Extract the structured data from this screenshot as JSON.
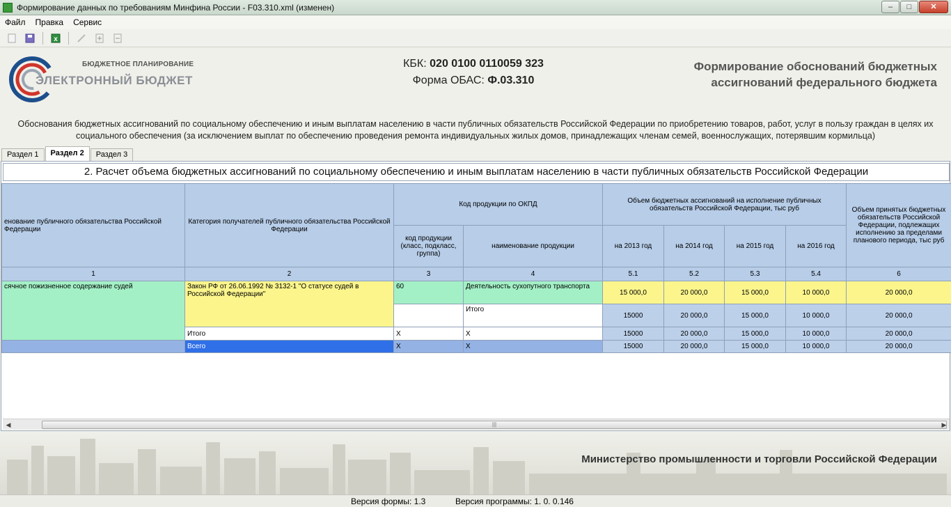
{
  "window": {
    "title": "Формирование данных по требованиям Минфина России - F03.310.xml (изменен)",
    "buttons": {
      "minimize": "–",
      "maximize": "□",
      "close": "✕"
    }
  },
  "menu": [
    "Файл",
    "Правка",
    "Сервис"
  ],
  "toolbar": {
    "icons": [
      "new-document-icon",
      "save-icon",
      "excel-export-icon",
      "edit-icon",
      "add-row-icon",
      "remove-row-icon"
    ]
  },
  "header": {
    "logo_small": "БЮДЖЕТНОЕ ПЛАНИРОВАНИЕ",
    "logo_big": "ЭЛЕКТРОННЫЙ БЮДЖЕТ",
    "kbk_label": "КБК:",
    "kbk_value": "020 0100 0110059 323",
    "form_label": "Форма ОБАС:",
    "form_value": "Ф.03.310",
    "title_line1": "Формирование обоснований бюджетных",
    "title_line2": "ассигнований федерального бюджета"
  },
  "description": {
    "line1": "Обоснования бюджетных ассигнований по социальному обеспечению и иным выплатам населению в части публичных обязательств Российской Федерации по приобретению товаров, работ, услуг в пользу граждан в целях их",
    "line2": "социального обеспечения (за исключением выплат по обеспечению проведения ремонта индивидуальных жилых домов, принадлежащих членам семей, военнослужащих, потерявшим кормильца)"
  },
  "tabs": [
    {
      "label": "Раздел 1",
      "active": false
    },
    {
      "label": "Раздел 2",
      "active": true
    },
    {
      "label": "Раздел 3",
      "active": false
    }
  ],
  "section": {
    "title": "2. Расчет объема бюджетных ассигнований по социальному обеспечению и иным выплатам населению в части публичных обязательств Российской Федерации"
  },
  "grid": {
    "headers": {
      "col1": "енование публичного обязательства Российской Федерации",
      "col2": "Категория получателей публичного обязательства Российской Федерации",
      "okpd": "Код продукции по ОКПД",
      "okpd_code": "код продукции (класс, подкласс, группа)",
      "okpd_name": "наименование продукции",
      "volume": "Объем бюджетных ассигнований на исполнение публичных обязательств Российской Федерации, тыс руб",
      "y2013": "на 2013 год",
      "y2014": "на 2014 год",
      "y2015": "на 2015 год",
      "y2016": "на 2016 год",
      "accepted": "Объем принятых бюджетных обязательств Российской Федерации, подлежащих исполнению за пределами планового периода, тыс руб"
    },
    "numbers": [
      "1",
      "2",
      "3",
      "4",
      "5.1",
      "5.2",
      "5.3",
      "5.4",
      "6"
    ],
    "rows": {
      "r1": {
        "obligation": "сячное пожизненное содержание судей",
        "category": "Закон РФ от 26.06.1992 № 3132-1 \"О статусе судей в Российской Федерации\"",
        "code": "60",
        "product": "Деятельность сухопутного транспорта",
        "v2013": "15 000,0",
        "v2014": "20 000,0",
        "v2015": "15 000,0",
        "v2016": "10 000,0",
        "v6": "20 000,0"
      },
      "r2": {
        "product": "Итого",
        "v2013": "15000",
        "v2014": "20 000,0",
        "v2015": "15 000,0",
        "v2016": "10 000,0",
        "v6": "20 000,0"
      },
      "r3": {
        "category": "Итого",
        "code": "X",
        "product": "X",
        "v2013": "15000",
        "v2014": "20 000,0",
        "v2015": "15 000,0",
        "v2016": "10 000,0",
        "v6": "20 000,0"
      },
      "r4": {
        "category": "Всего",
        "code": "X",
        "product": "X",
        "v2013": "15000",
        "v2014": "20 000,0",
        "v2015": "15 000,0",
        "v2016": "10 000,0",
        "v6": "20 000,0"
      }
    }
  },
  "footer": {
    "ministry": "Министерство промышленности и торговли Российской Федерации"
  },
  "status": {
    "form_version": "Версия формы: 1.3",
    "program_version": "Версия программы: 1. 0. 0.146"
  },
  "colors": {
    "header_blue": "#b7cde8",
    "green_cell": "#a3f0c6",
    "yellow_cell": "#fbf58c",
    "selection": "#2f6fe8"
  }
}
